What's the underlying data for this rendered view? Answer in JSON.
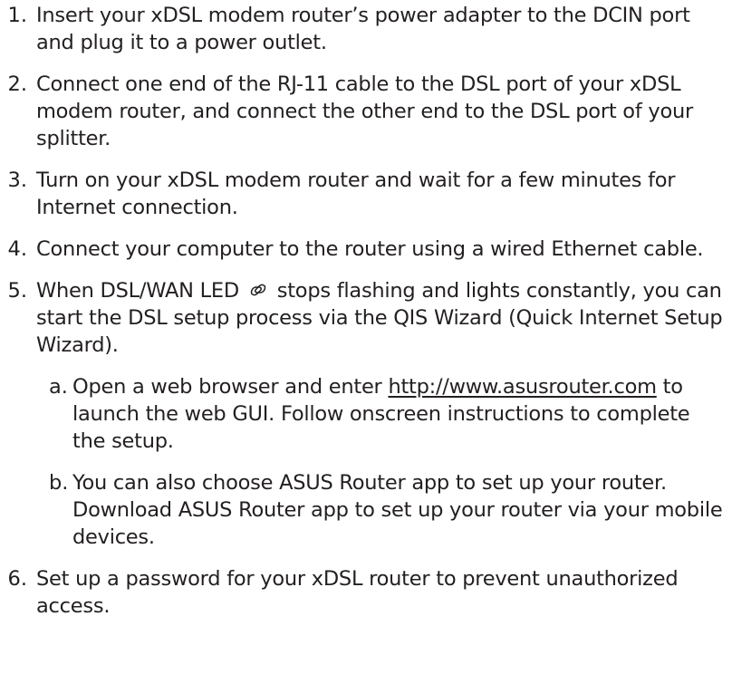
{
  "steps": [
    {
      "num": "1.",
      "text": "Insert your xDSL modem router’s power adapter to the DCIN port and plug it to a power outlet."
    },
    {
      "num": "2.",
      "text": "Connect one end of the RJ-11 cable to the DSL port of your xDSL modem router, and connect the other end to the DSL port of your splitter."
    },
    {
      "num": "3.",
      "text": "Turn on your xDSL modem router and wait for a few minutes for Internet connection."
    },
    {
      "num": "4.",
      "text": "Connect your computer to the router using a wired Ethernet cable."
    },
    {
      "num": "5.",
      "text_before_icon": "When DSL/WAN LED",
      "icon": "dsl-wan-led-icon",
      "text_after_icon": "stops flashing and lights constantly, you can start the DSL setup process via the QIS Wizard (Quick Internet Setup Wizard)."
    },
    {
      "num": "6.",
      "text": "Set up a password for your xDSL router to prevent unauthorized access."
    }
  ],
  "substeps": [
    {
      "letter": "a.",
      "prefix": "Open a web browser and enter ",
      "link": "http://www.asusrouter.com",
      "suffix": " to launch the web GUI. Follow onscreen instructions to complete the setup."
    },
    {
      "letter": "b.",
      "text": "You can also choose ASUS Router app to set up your router. Download ASUS Router app to set up your router via your mobile devices."
    }
  ]
}
